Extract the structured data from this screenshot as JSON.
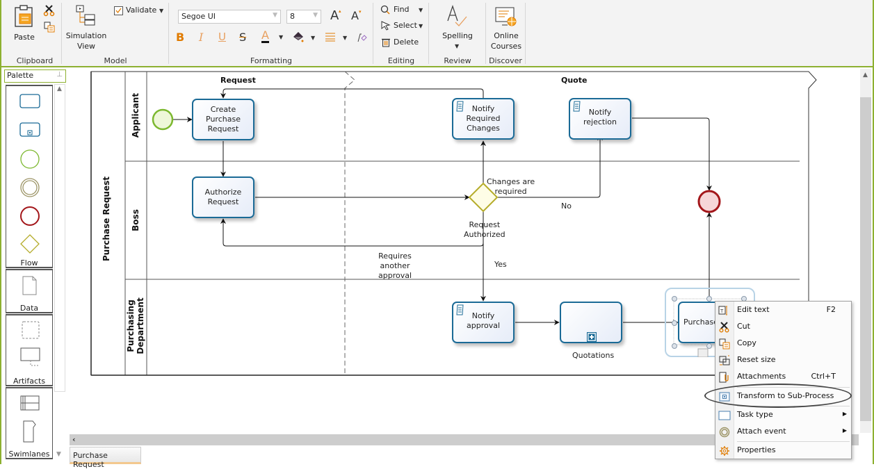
{
  "ribbon": {
    "clipboard": {
      "paste": "Paste",
      "cut_icon": "scissors-icon",
      "copy_icon": "copy-icon",
      "group": "Clipboard"
    },
    "model": {
      "simulation_view": [
        "Simulation",
        "View"
      ],
      "validate": "Validate",
      "group": "Model"
    },
    "formatting": {
      "font_family": "Segoe UI",
      "font_size": "8",
      "grow_font": "A",
      "shrink_font": "A",
      "bold": "B",
      "italic": "I",
      "underline": "U",
      "strike": "S",
      "font_color": "A",
      "group": "Formatting"
    },
    "editing": {
      "find": "Find",
      "select": "Select",
      "delete": "Delete",
      "group": "Editing"
    },
    "review": {
      "spelling": "Spelling",
      "group": "Review"
    },
    "discover": {
      "online_courses": [
        "Online",
        "Courses"
      ],
      "group": "Discover"
    }
  },
  "palette": {
    "title": "Palette",
    "sections": [
      "Flow",
      "Data",
      "Artifacts",
      "Swimlanes"
    ]
  },
  "diagram": {
    "pool": "Purchase Request",
    "lanes": [
      "Applicant",
      "Boss",
      [
        "Purchasing",
        "Department"
      ]
    ],
    "phases": [
      "Request",
      "Quote"
    ],
    "tasks": {
      "create": [
        "Create",
        "Purchase",
        "Request"
      ],
      "authorize": [
        "Authorize",
        "Request"
      ],
      "notify_changes": [
        "Notify Required",
        "Changes"
      ],
      "notify_rejection": "Notify rejection",
      "notify_approval": "Notify approval",
      "quotations": "Quotations",
      "purchase": "Purchase"
    },
    "gateway_labels": {
      "changes": [
        "Changes are",
        "required"
      ],
      "authorized": [
        "Request",
        "Authorized"
      ],
      "another": [
        "Requires",
        "another",
        "approval"
      ],
      "no": "No",
      "yes": "Yes"
    },
    "colors": {
      "task_border": "#1a6a96",
      "start": "#7cb82f",
      "end": "#a3161a",
      "gateway": "#b5ac2a"
    }
  },
  "tabs": {
    "active": "Purchase Request"
  },
  "context_menu": {
    "items": [
      {
        "label": "Edit text",
        "shortcut": "F2",
        "icon": "edit-text-icon"
      },
      {
        "label": "Cut",
        "shortcut": "",
        "icon": "scissors-icon"
      },
      {
        "label": "Copy",
        "shortcut": "",
        "icon": "copy-icon"
      },
      {
        "label": "Reset size",
        "shortcut": "",
        "icon": "reset-size-icon"
      },
      {
        "label": "Attachments",
        "shortcut": "Ctrl+T",
        "icon": "attachment-icon"
      },
      {
        "label": "Transform to Sub-Process",
        "shortcut": "",
        "icon": "subprocess-icon"
      },
      {
        "label": "Task type",
        "shortcut": "",
        "icon": "task-type-icon",
        "submenu": true
      },
      {
        "label": "Attach event",
        "shortcut": "",
        "icon": "attach-event-icon",
        "submenu": true
      },
      {
        "label": "Properties",
        "shortcut": "",
        "icon": "gear-icon"
      }
    ]
  }
}
